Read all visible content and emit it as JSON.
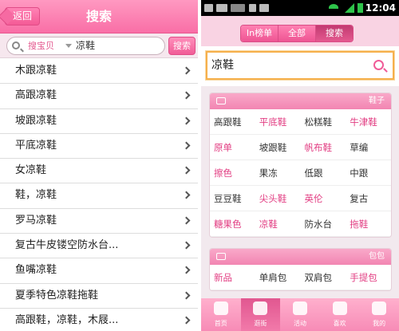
{
  "left": {
    "back_label": "返回",
    "title": "搜索",
    "search": {
      "category": "搜宝贝",
      "query": "凉鞋",
      "button_label": "搜索"
    },
    "suggestions": [
      "木跟凉鞋",
      "高跟凉鞋",
      "坡跟凉鞋",
      "平底凉鞋",
      "女凉鞋",
      "鞋，凉鞋",
      "罗马凉鞋",
      "复古牛皮镂空防水台...",
      "鱼嘴凉鞋",
      "夏季特色凉鞋拖鞋",
      "高跟鞋，凉鞋，木屐..."
    ]
  },
  "right": {
    "status_bar": {
      "time": "12:04"
    },
    "segments": [
      {
        "label": "In榜单",
        "active": false
      },
      {
        "label": "全部",
        "active": false
      },
      {
        "label": "搜索",
        "active": true
      }
    ],
    "search": {
      "query": "凉鞋"
    },
    "categories": [
      {
        "title": "鞋子",
        "icon": "shoe-icon",
        "items": [
          {
            "label": "高跟鞋",
            "hl": false
          },
          {
            "label": "平底鞋",
            "hl": true
          },
          {
            "label": "松糕鞋",
            "hl": false
          },
          {
            "label": "牛津鞋",
            "hl": true
          },
          {
            "label": "原单",
            "hl": true
          },
          {
            "label": "坡跟鞋",
            "hl": false
          },
          {
            "label": "帆布鞋",
            "hl": true
          },
          {
            "label": "草编",
            "hl": false
          },
          {
            "label": "擦色",
            "hl": true
          },
          {
            "label": "果冻",
            "hl": false
          },
          {
            "label": "低跟",
            "hl": false
          },
          {
            "label": "中跟",
            "hl": false
          },
          {
            "label": "豆豆鞋",
            "hl": false
          },
          {
            "label": "尖头鞋",
            "hl": true
          },
          {
            "label": "英伦",
            "hl": true
          },
          {
            "label": "复古",
            "hl": false
          },
          {
            "label": "糖果色",
            "hl": true
          },
          {
            "label": "凉鞋",
            "hl": true
          },
          {
            "label": "防水台",
            "hl": false
          },
          {
            "label": "拖鞋",
            "hl": true
          }
        ]
      },
      {
        "title": "包包",
        "icon": "bag-icon",
        "items": [
          {
            "label": "新品",
            "hl": true
          },
          {
            "label": "单肩包",
            "hl": false
          },
          {
            "label": "双肩包",
            "hl": false
          },
          {
            "label": "手提包",
            "hl": true
          }
        ]
      }
    ],
    "tabs": [
      {
        "label": "首页",
        "icon": "home-icon",
        "active": false
      },
      {
        "label": "逛街",
        "icon": "cart-icon",
        "active": true
      },
      {
        "label": "活动",
        "icon": "gift-icon",
        "active": false
      },
      {
        "label": "喜欢",
        "icon": "heart-icon",
        "active": false
      },
      {
        "label": "我的",
        "icon": "user-icon",
        "active": false
      }
    ]
  },
  "colors": {
    "accent": "#f96ea6",
    "highlight_text": "#e23d82",
    "search_focus": "#f6b04c"
  }
}
